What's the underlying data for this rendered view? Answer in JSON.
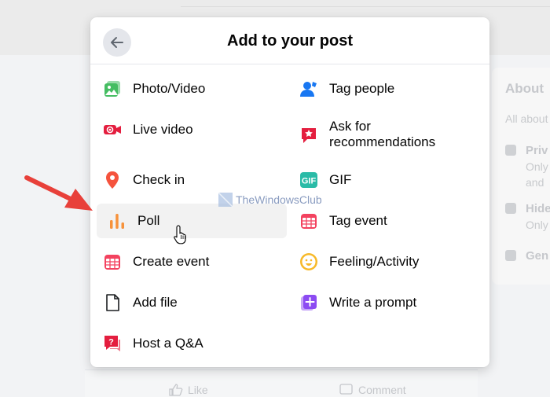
{
  "dialog": {
    "title": "Add to your post"
  },
  "options": [
    {
      "label": "Photo/Video",
      "icon": "photo-video-icon"
    },
    {
      "label": "Tag people",
      "icon": "tag-people-icon"
    },
    {
      "label": "Live video",
      "icon": "live-video-icon"
    },
    {
      "label": "Ask for recommendations",
      "icon": "recommendations-icon"
    },
    {
      "label": "Check in",
      "icon": "check-in-icon"
    },
    {
      "label": "GIF",
      "icon": "gif-icon"
    },
    {
      "label": "Poll",
      "icon": "poll-icon"
    },
    {
      "label": "Tag event",
      "icon": "tag-event-icon"
    },
    {
      "label": "Create event",
      "icon": "create-event-icon"
    },
    {
      "label": "Feeling/Activity",
      "icon": "feeling-icon"
    },
    {
      "label": "Add file",
      "icon": "add-file-icon"
    },
    {
      "label": "Write a prompt",
      "icon": "write-prompt-icon"
    },
    {
      "label": "Host a Q&A",
      "icon": "host-qa-icon"
    }
  ],
  "watermark": "TheWindowsClub",
  "background": {
    "about_title": "About",
    "about_sub": "All about",
    "rows": [
      {
        "t1": "Priv",
        "t2": "Only",
        "t3": "and"
      },
      {
        "t1": "Hide",
        "t2": "Only"
      },
      {
        "t1": "Gen"
      }
    ],
    "like_label": "Like",
    "comment_label": "Comment"
  },
  "colors": {
    "accent_red": "#e41e3f",
    "green": "#45bd62",
    "blue": "#1877f2",
    "orange": "#f7923b",
    "teal": "#2abba7",
    "purple": "#8c4bf2",
    "yellow": "#f7b928",
    "pink": "#f3425f"
  }
}
